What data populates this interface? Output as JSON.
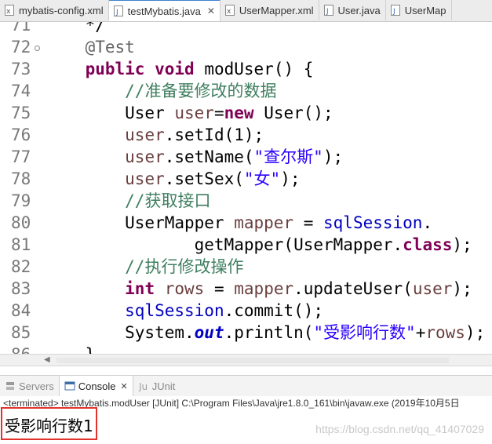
{
  "editor_tabs": [
    {
      "label": "mybatis-config.xml",
      "icon": "xml-file-icon",
      "active": false
    },
    {
      "label": "testMybatis.java",
      "icon": "java-file-icon",
      "active": true,
      "close": "✕"
    },
    {
      "label": "UserMapper.xml",
      "icon": "xml-file-icon",
      "active": false
    },
    {
      "label": "User.java",
      "icon": "java-file-icon",
      "active": false
    },
    {
      "label": "UserMap",
      "icon": "java-file-icon",
      "active": false
    }
  ],
  "code": {
    "lines": [
      {
        "n": "71",
        "parts": [
          [
            "",
            "    */"
          ]
        ]
      },
      {
        "n": "72",
        "fold": true,
        "parts": [
          [
            "",
            "    "
          ],
          [
            "ann",
            "@Test"
          ]
        ]
      },
      {
        "n": "73",
        "parts": [
          [
            "",
            "    "
          ],
          [
            "kw",
            "public"
          ],
          [
            "",
            " "
          ],
          [
            "kw",
            "void"
          ],
          [
            "",
            " modUser() {"
          ]
        ]
      },
      {
        "n": "74",
        "parts": [
          [
            "",
            "        "
          ],
          [
            "cm",
            "//准备要修改的数据"
          ]
        ]
      },
      {
        "n": "75",
        "parts": [
          [
            "",
            "        User "
          ],
          [
            "loc",
            "user"
          ],
          [
            "",
            "="
          ],
          [
            "kw",
            "new"
          ],
          [
            "",
            " User();"
          ]
        ]
      },
      {
        "n": "76",
        "parts": [
          [
            "",
            "        "
          ],
          [
            "loc",
            "user"
          ],
          [
            "",
            ".setId(1);"
          ]
        ]
      },
      {
        "n": "77",
        "parts": [
          [
            "",
            "        "
          ],
          [
            "loc",
            "user"
          ],
          [
            "",
            ".setName("
          ],
          [
            "str",
            "\"查尔斯\""
          ],
          [
            "",
            ");"
          ]
        ]
      },
      {
        "n": "78",
        "parts": [
          [
            "",
            "        "
          ],
          [
            "loc",
            "user"
          ],
          [
            "",
            ".setSex("
          ],
          [
            "str",
            "\"女\""
          ],
          [
            "",
            ");"
          ]
        ]
      },
      {
        "n": "79",
        "parts": [
          [
            "",
            "        "
          ],
          [
            "cm",
            "//获取接口"
          ]
        ]
      },
      {
        "n": "80",
        "parts": [
          [
            "",
            "        UserMapper "
          ],
          [
            "loc",
            "mapper"
          ],
          [
            "",
            " = "
          ],
          [
            "fld",
            "sqlSession"
          ],
          [
            "",
            "."
          ]
        ]
      },
      {
        "n": "81",
        "parts": [
          [
            "",
            "               getMapper(UserMapper."
          ],
          [
            "kw",
            "class"
          ],
          [
            "",
            ");"
          ]
        ]
      },
      {
        "n": "82",
        "parts": [
          [
            "",
            "        "
          ],
          [
            "cm",
            "//执行修改操作"
          ]
        ]
      },
      {
        "n": "83",
        "parts": [
          [
            "",
            "        "
          ],
          [
            "kw",
            "int"
          ],
          [
            "",
            " "
          ],
          [
            "loc",
            "rows"
          ],
          [
            "",
            " = "
          ],
          [
            "loc",
            "mapper"
          ],
          [
            "",
            ".updateUser("
          ],
          [
            "loc",
            "user"
          ],
          [
            "",
            ");"
          ]
        ]
      },
      {
        "n": "84",
        "parts": [
          [
            "",
            "        "
          ],
          [
            "fld",
            "sqlSession"
          ],
          [
            "",
            ".commit();"
          ]
        ]
      },
      {
        "n": "85",
        "parts": [
          [
            "",
            "        System."
          ],
          [
            "sfld",
            "out"
          ],
          [
            "",
            ".println("
          ],
          [
            "str",
            "\"受影响行数\""
          ],
          [
            "",
            "+"
          ],
          [
            "loc",
            "rows"
          ],
          [
            "",
            ");"
          ]
        ]
      },
      {
        "n": "86",
        "parts": [
          [
            "",
            "    }"
          ]
        ]
      }
    ]
  },
  "panel_tabs": [
    {
      "label": "Servers",
      "icon": "servers-icon",
      "active": false
    },
    {
      "label": "Console",
      "icon": "console-icon",
      "active": true,
      "close": "✕"
    },
    {
      "label": "JUnit",
      "icon": "junit-icon",
      "active": false
    }
  ],
  "console": {
    "status": "<terminated> testMybatis.modUser [JUnit] C:\\Program Files\\Java\\jre1.8.0_161\\bin\\javaw.exe (2019年10月5日",
    "output": "受影响行数1",
    "watermark": "https://blog.csdn.net/qq_41407029"
  },
  "colors": {
    "keyword": "#7f0055",
    "comment": "#3f7f5f",
    "string": "#2a00ff",
    "field": "#0000c0",
    "highlight_box": "#e1332c"
  }
}
